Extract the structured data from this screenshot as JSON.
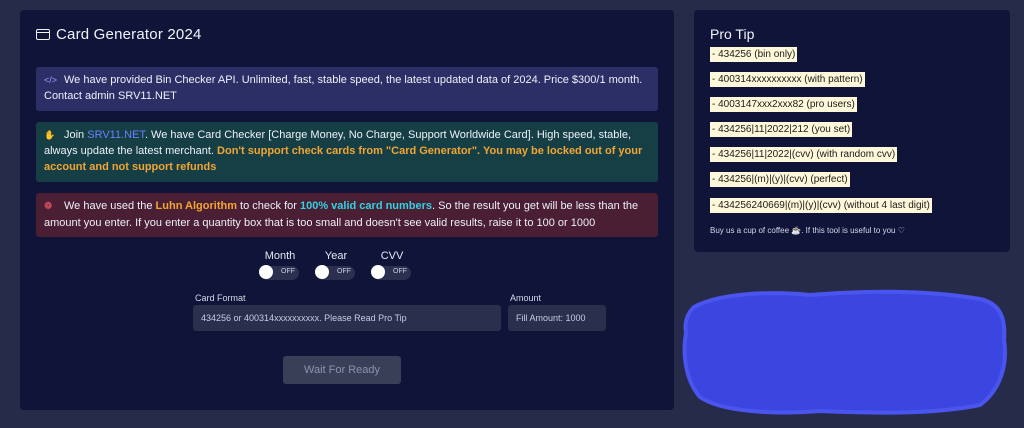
{
  "main": {
    "title": "Card Generator 2024",
    "alerts": [
      {
        "icon": "code-icon",
        "text": "We have provided Bin Checker API. Unlimited, fast, stable speed, the latest updated data of 2024. Price $300/1 month. Contact admin SRV11.NET"
      },
      {
        "icon": "hand-icon",
        "text_before": "Join ",
        "link": "SRV11.NET",
        "text_mid": ". We have Card Checker [Charge Money, No Charge, Support Worldwide Card]. High speed, stable, always update the latest merchant. ",
        "warning": "Don't support check cards from \"Card Generator\". You may be locked out of your account and not support refunds"
      },
      {
        "icon": "badge-icon",
        "text_before": "We have used the ",
        "highlight1": "Luhn Algorithm",
        "text_mid": " to check for ",
        "highlight2": "100% valid card numbers",
        "text_after": ". So the result you get will be less than the amount you enter. If you enter a quantity box that is too small and doesn't see valid results, raise it to 100 or 1000"
      }
    ],
    "toggles": [
      {
        "label": "Month",
        "state": "OFF"
      },
      {
        "label": "Year",
        "state": "OFF"
      },
      {
        "label": "CVV",
        "state": "OFF"
      }
    ],
    "card_format": {
      "label": "Card Format",
      "placeholder": "434256 or 400314xxxxxxxxxx. Please Read Pro Tip"
    },
    "amount": {
      "label": "Amount",
      "placeholder": "Fill Amount: 1000"
    },
    "button_label": "Wait For Ready"
  },
  "pro_tip": {
    "title": "Pro Tip",
    "items": [
      "- 434256 (bin only)",
      "- 400314xxxxxxxxxx (with pattern)",
      "- 4003147xxx2xxx82 (pro users)",
      "- 434256|11|2022|212 (you set)",
      "- 434256|11|2022|(cvv) (with random cvv)",
      "- 434256|(m)|(y)|(cvv) (perfect)",
      "- 434256240669|(m)|(y)|(cvv) (without 4 last digit)"
    ],
    "footer": "Buy us a cup of coffee ☕. If this tool is useful to you ♡"
  },
  "colors": {
    "background": "#272b4a",
    "panel": "#0f1438",
    "scribble": "#3b45e0"
  }
}
